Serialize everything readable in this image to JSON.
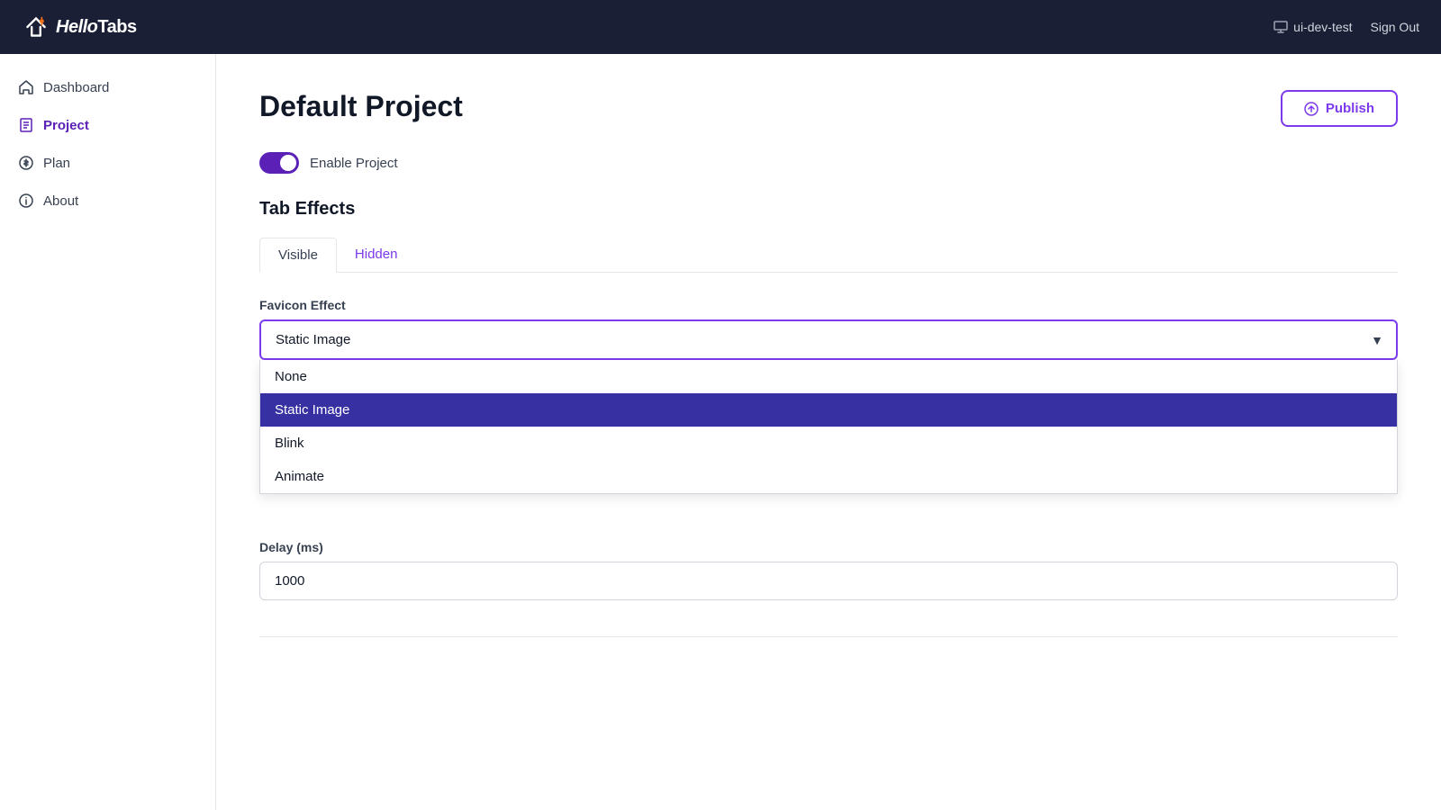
{
  "header": {
    "logo": "HelloTabs",
    "user": "ui-dev-test",
    "signout_label": "Sign Out"
  },
  "sidebar": {
    "items": [
      {
        "id": "dashboard",
        "label": "Dashboard",
        "icon": "home"
      },
      {
        "id": "project",
        "label": "Project",
        "icon": "file",
        "active": true
      },
      {
        "id": "plan",
        "label": "Plan",
        "icon": "dollar"
      },
      {
        "id": "about",
        "label": "About",
        "icon": "info"
      }
    ]
  },
  "main": {
    "page_title": "Default Project",
    "publish_label": "Publish",
    "enable_label": "Enable Project",
    "section_title": "Tab Effects",
    "tabs": [
      {
        "id": "visible",
        "label": "Visible"
      },
      {
        "id": "hidden",
        "label": "Hidden"
      }
    ],
    "active_tab": "visible",
    "favicon_effect": {
      "label": "Favicon Effect",
      "selected": "Static Image",
      "options": [
        {
          "id": "none",
          "label": "None"
        },
        {
          "id": "static-image",
          "label": "Static Image",
          "selected": true
        },
        {
          "id": "blink",
          "label": "Blink"
        },
        {
          "id": "animate",
          "label": "Animate"
        }
      ]
    },
    "delay": {
      "label": "Delay (ms)",
      "value": "1000"
    }
  }
}
